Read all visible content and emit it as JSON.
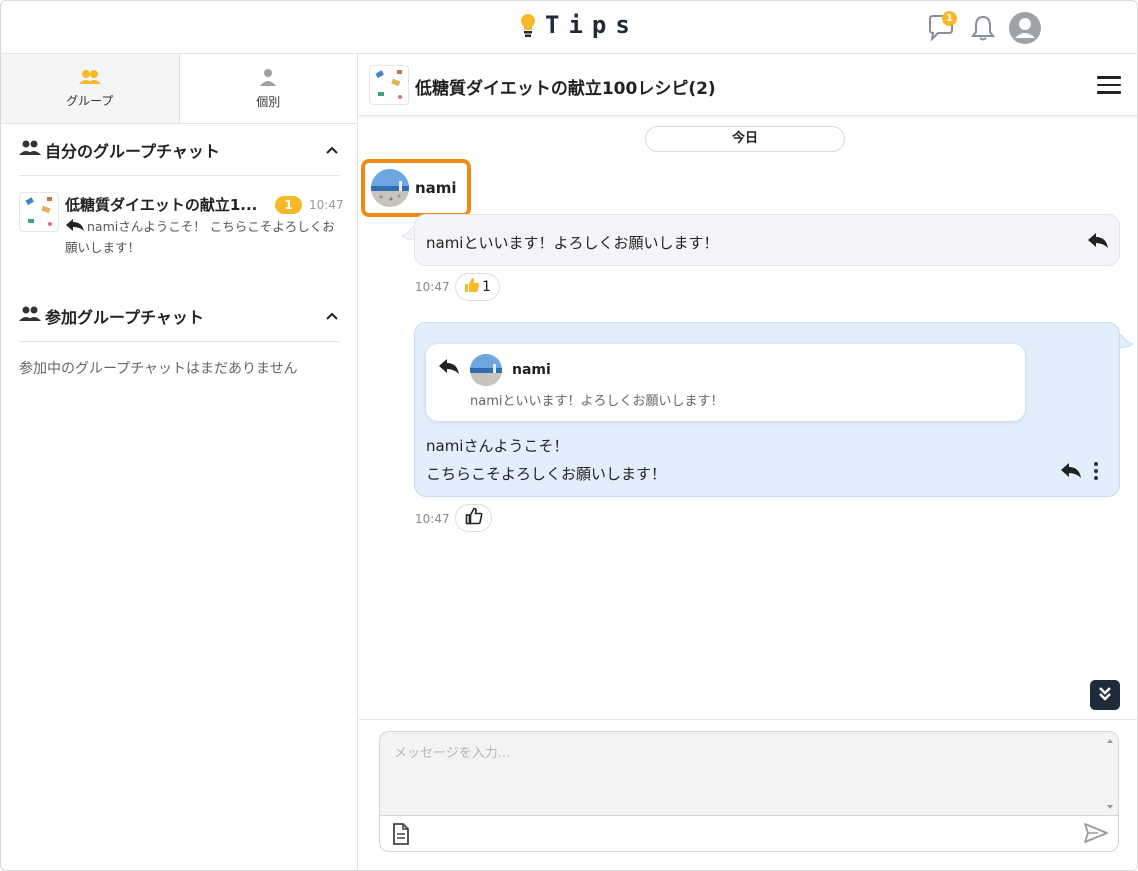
{
  "header": {
    "logo_text": "Tips",
    "chat_badge": "1",
    "icons": [
      "lightbulb-icon",
      "chat-bubble-icon",
      "bell-icon",
      "user-avatar-icon"
    ]
  },
  "sidebar": {
    "tabs": [
      {
        "label": "グループ",
        "icon": "group-icon",
        "active": true
      },
      {
        "label": "個別",
        "icon": "person-icon",
        "active": false
      }
    ],
    "my_groups": {
      "title": "自分のグループチャット",
      "items": [
        {
          "title": "低糖質ダイエットの献立1...",
          "unread": "1",
          "time": "10:47",
          "preview": "namiさんようこそ！ こちらこそよろしくお願いします！"
        }
      ]
    },
    "joined_groups": {
      "title": "参加グループチャット",
      "empty": "参加中のグループチャットはまだありません"
    }
  },
  "chat": {
    "title": "低糖質ダイエットの献立100レシピ(2)",
    "date_label": "今日",
    "messages": [
      {
        "sender": "nami",
        "text": "namiといいます！よろしくお願いします！",
        "time": "10:47",
        "reaction_count": "1"
      },
      {
        "quote_sender": "nami",
        "quote_text": "namiといいます！よろしくお願いします！",
        "line1": "namiさんようこそ！",
        "line2": "こちらこそよろしくお願いします！",
        "time": "10:47"
      }
    ],
    "composer_placeholder": "メッセージを入力..."
  },
  "colors": {
    "accent": "#f7b928",
    "highlight": "#f08c16",
    "outgoing_bubble": "#e2eefc",
    "incoming_bubble": "#f4f5f8",
    "dark": "#1f2a3a"
  }
}
